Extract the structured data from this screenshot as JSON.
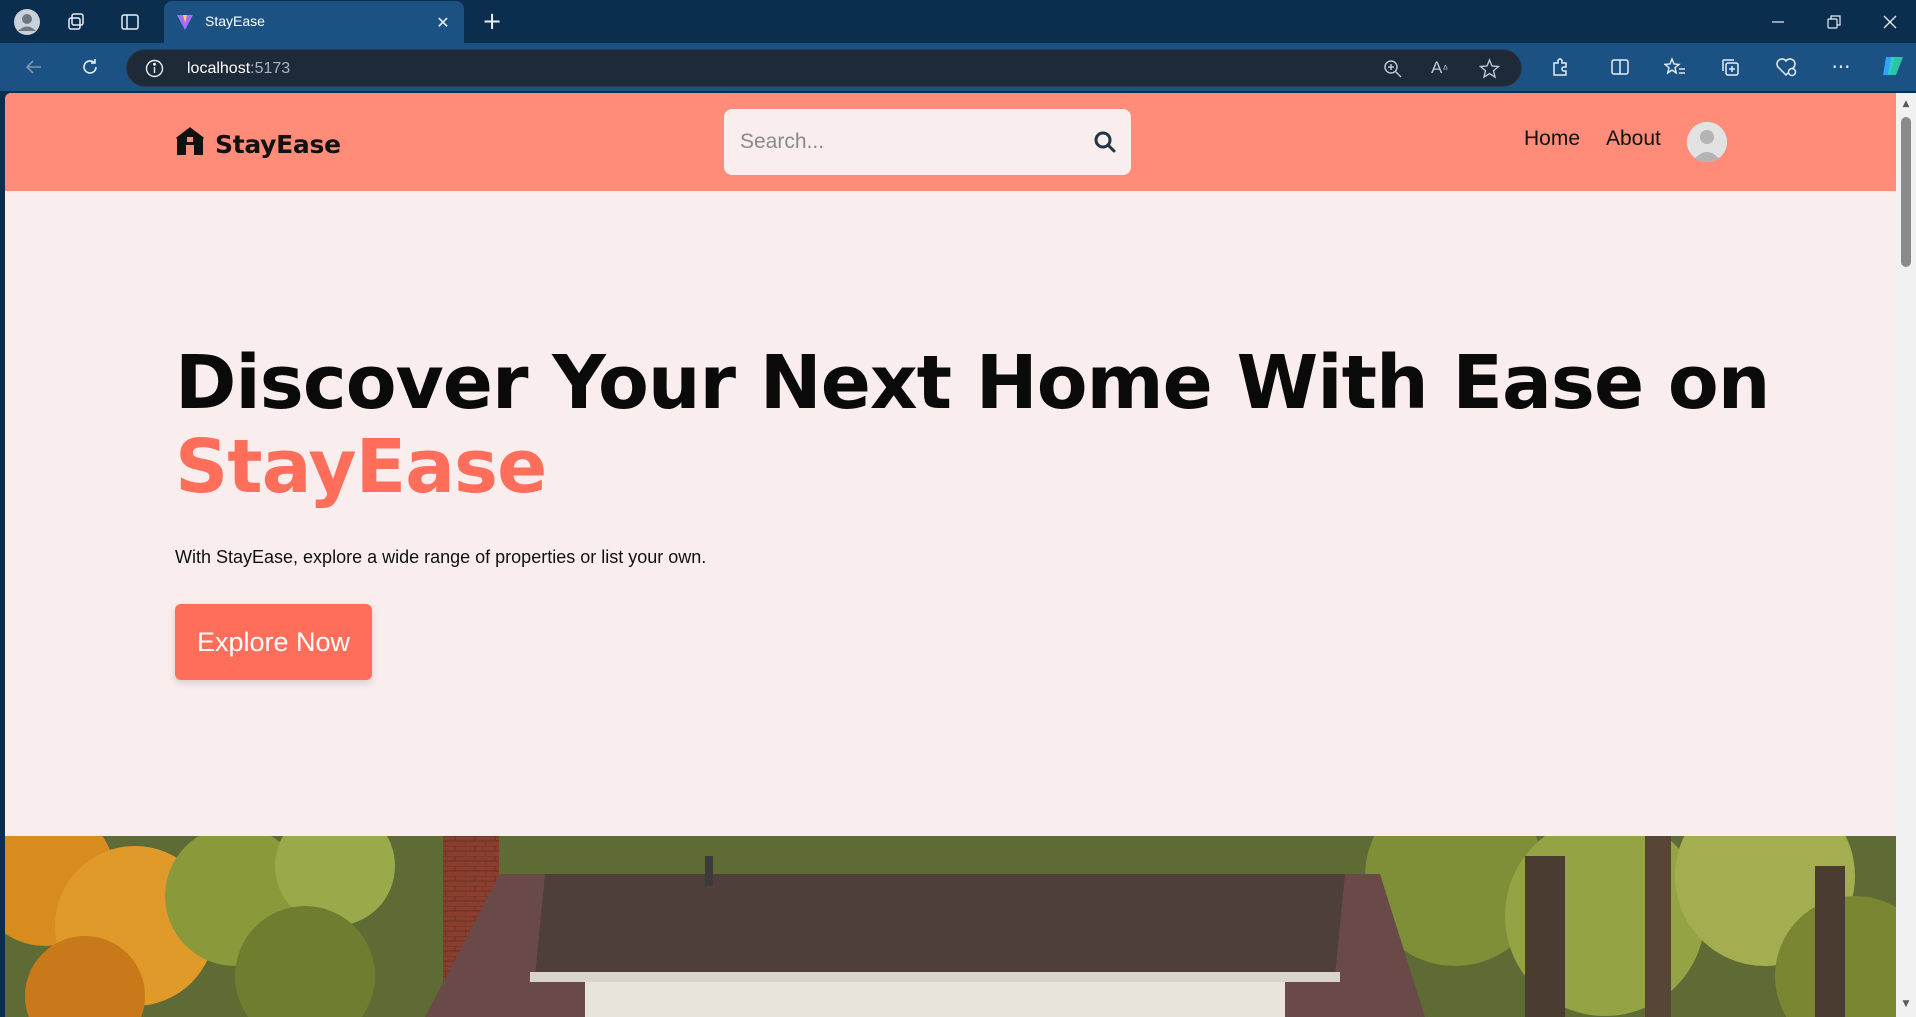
{
  "browser": {
    "tab_title": "StayEase",
    "url_host": "localhost",
    "url_port": ":5173"
  },
  "site": {
    "brand": "StayEase",
    "search_placeholder": "Search...",
    "nav": {
      "home": "Home",
      "about": "About"
    },
    "accent_color": "#ff6e5a",
    "nav_bg_color": "#ff8c78"
  },
  "hero": {
    "title": "Discover Your Next Home With Ease on",
    "title_highlight": "StayEase",
    "subtitle": "With StayEase, explore a wide range of properties or list your own.",
    "cta_label": "Explore Now"
  }
}
